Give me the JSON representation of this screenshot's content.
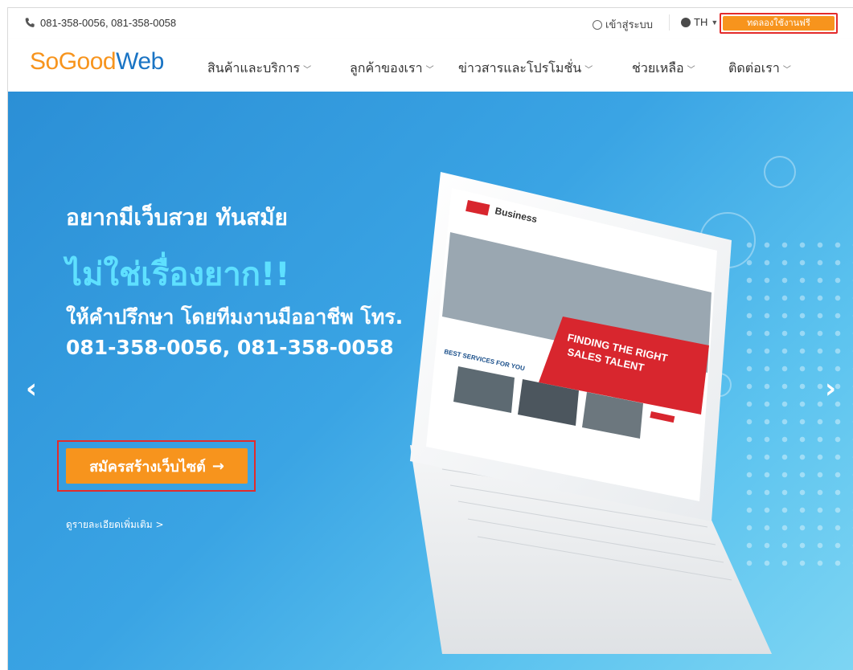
{
  "topbar": {
    "phone": "081-358-0056, 081-358-0058",
    "login": "เข้าสู่ระบบ",
    "lang": "TH",
    "trial_button": "ทดลองใช้งานฟรี"
  },
  "logo": {
    "so": "So",
    "goo": "Goo",
    "d": "d",
    "web": "Web"
  },
  "nav": [
    {
      "label": "สินค้าและบริการ"
    },
    {
      "label": "ลูกค้าของเรา"
    },
    {
      "label": "ข่าวสารและโปรโมชั่น"
    },
    {
      "label": "ช่วยเหลือ"
    },
    {
      "label": "ติดต่อเรา"
    }
  ],
  "hero": {
    "line1": "อยากมีเว็บสวย ทันสมัย",
    "line2": "ไม่ใช่เรื่องยาก!!",
    "line3": "ให้คำปรึกษา โดยทีมงานมืออาชีพ โทร. 081-358-0056, 081-358-0058",
    "cta": "สมัครสร้างเว็บไซต์",
    "cta_arrow": "→",
    "more": "ดูรายละเอียดเพิ่มเติม >",
    "prev": "‹",
    "next": "›"
  },
  "laptop_screen": {
    "brand": "Business",
    "headline1": "FINDING THE RIGHT",
    "headline2": "SALES TALENT",
    "services": "BEST SERVICES FOR YOU"
  },
  "colors": {
    "accent": "#f7941d",
    "highlight": "#e32b2b",
    "brand_blue": "#1a74c4",
    "hero_cyan": "#5ee0ff"
  }
}
